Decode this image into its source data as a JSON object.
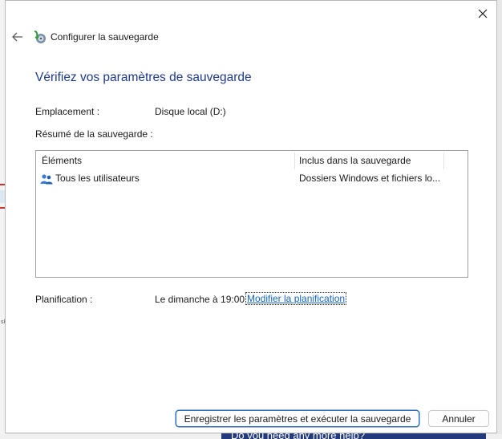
{
  "window": {
    "title": "Configurer la sauvegarde"
  },
  "background": {
    "banner_text": "Do you need any more help?"
  },
  "main": {
    "heading": "Vérifiez vos paramètres de sauvegarde",
    "location_label": "Emplacement :",
    "location_value": "Disque local (D:)",
    "summary_label": "Résumé de la sauvegarde :",
    "table": {
      "columns": [
        "Éléments",
        "Inclus dans la sauvegarde"
      ],
      "rows": [
        {
          "item": "Tous les utilisateurs",
          "included": "Dossiers Windows et fichiers lo..."
        }
      ]
    },
    "schedule_label": "Planification :",
    "schedule_value": "Le dimanche à 19:00",
    "schedule_link": "Modifier la planification"
  },
  "footer": {
    "save_run_label": "Enregistrer les paramètres et exécuter la sauvegarde",
    "cancel_label": "Annuler"
  },
  "icons": {
    "close": "close-icon",
    "back": "back-arrow-icon",
    "title": "backup-icon",
    "users": "users-icon"
  },
  "colors": {
    "heading": "#1e3a8a",
    "link": "#1565c0",
    "primary_border": "#2f6fbf"
  }
}
